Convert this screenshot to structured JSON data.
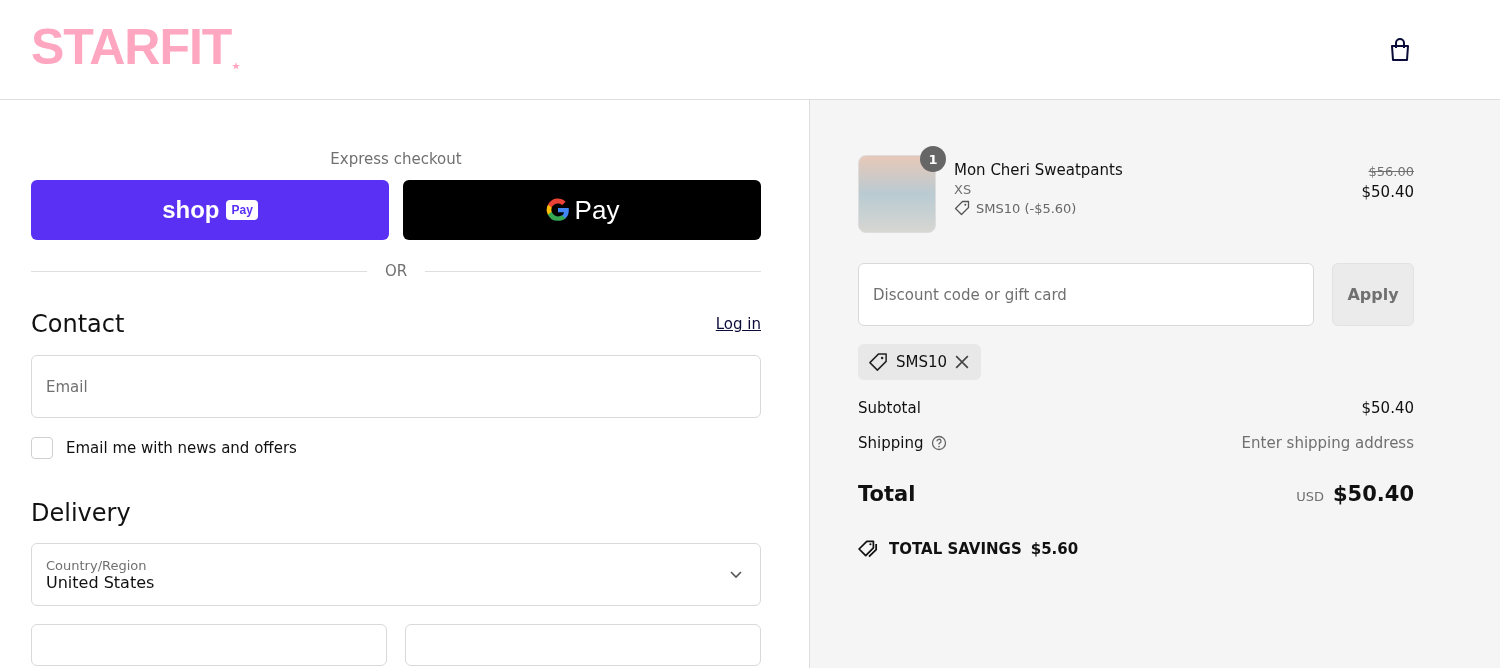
{
  "header": {
    "logo": "STARFIT"
  },
  "express": {
    "title": "Express checkout",
    "shop_pay": {
      "word": "shop",
      "badge": "Pay"
    },
    "google_pay": {
      "word": "Pay"
    },
    "divider": "OR"
  },
  "contact": {
    "heading": "Contact",
    "login_link": "Log in",
    "email": {
      "placeholder": "Email"
    },
    "newsletter": {
      "label": "Email me with news and offers",
      "checked": false
    }
  },
  "delivery": {
    "heading": "Delivery",
    "country": {
      "label": "Country/Region",
      "value": "United States"
    }
  },
  "summary": {
    "item": {
      "name": "Mon Cheri Sweatpants",
      "quantity": "1",
      "variant": "XS",
      "discount": "SMS10 (-$5.60)",
      "original_price": "$56.00",
      "price": "$50.40"
    },
    "discount_field": {
      "placeholder": "Discount code or gift card"
    },
    "apply_button": "Apply",
    "applied_code": "SMS10",
    "subtotal": {
      "label": "Subtotal",
      "value": "$50.40"
    },
    "shipping": {
      "label": "Shipping",
      "value": "Enter shipping address"
    },
    "total": {
      "label": "Total",
      "currency": "USD",
      "value": "$50.40"
    },
    "savings": {
      "label": "TOTAL SAVINGS",
      "value": "$5.60"
    }
  }
}
